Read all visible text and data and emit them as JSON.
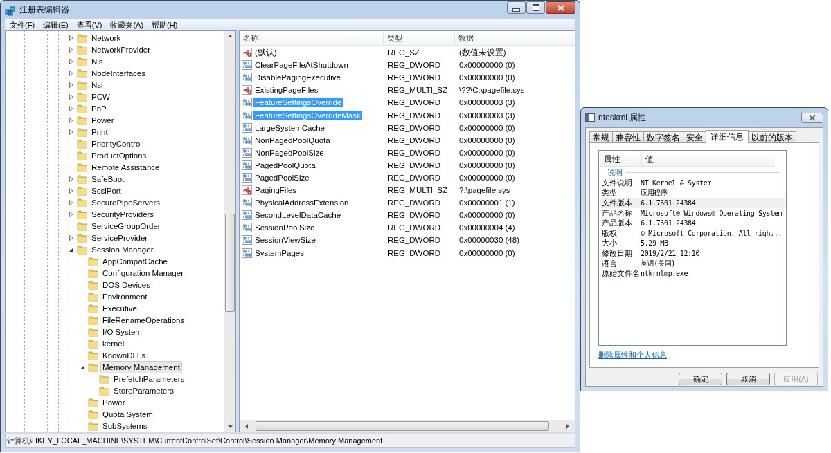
{
  "regedit": {
    "title": "注册表编辑器",
    "menu": [
      "文件(F)",
      "编辑(E)",
      "查看(V)",
      "收藏夹(A)",
      "帮助(H)"
    ],
    "tree": [
      {
        "label": "Network",
        "expanded": false,
        "selected": false
      },
      {
        "label": "NetworkProvider",
        "expanded": false,
        "selected": false
      },
      {
        "label": "Nls",
        "expanded": false,
        "selected": false
      },
      {
        "label": "NodeInterfaces",
        "expanded": false,
        "selected": false
      },
      {
        "label": "Nsi",
        "expanded": false,
        "selected": false
      },
      {
        "label": "PCW",
        "expanded": false,
        "selected": false
      },
      {
        "label": "PnP",
        "expanded": false,
        "selected": false
      },
      {
        "label": "Power",
        "expanded": false,
        "selected": false
      },
      {
        "label": "Print",
        "expanded": false,
        "selected": false
      },
      {
        "label": "PriorityControl",
        "selected": false
      },
      {
        "label": "ProductOptions",
        "selected": false
      },
      {
        "label": "Remote Assistance",
        "selected": false
      },
      {
        "label": "SafeBoot",
        "expanded": false,
        "selected": false
      },
      {
        "label": "ScsiPort",
        "expanded": false,
        "selected": false
      },
      {
        "label": "SecurePipeServers",
        "expanded": false,
        "selected": false
      },
      {
        "label": "SecurityProviders",
        "expanded": false,
        "selected": false
      },
      {
        "label": "ServiceGroupOrder",
        "selected": false
      },
      {
        "label": "ServiceProvider",
        "expanded": false,
        "selected": false
      },
      {
        "label": "Session Manager",
        "expanded": true,
        "selected": false,
        "children": [
          {
            "label": "AppCompatCache",
            "selected": false
          },
          {
            "label": "Configuration Manager",
            "selected": false
          },
          {
            "label": "DOS Devices",
            "selected": false
          },
          {
            "label": "Environment",
            "selected": false
          },
          {
            "label": "Executive",
            "selected": false
          },
          {
            "label": "FileRenameOperations",
            "selected": false
          },
          {
            "label": "I/O System",
            "selected": false
          },
          {
            "label": "kernel",
            "selected": false
          },
          {
            "label": "KnownDLLs",
            "selected": false
          },
          {
            "label": "Memory Management",
            "expanded": true,
            "selected": true,
            "children": [
              {
                "label": "PrefetchParameters",
                "selected": false
              },
              {
                "label": "StoreParameters",
                "selected": false
              }
            ]
          },
          {
            "label": "Power",
            "selected": false
          },
          {
            "label": "Quota System",
            "selected": false
          },
          {
            "label": "SubSystems",
            "selected": false
          }
        ]
      }
    ],
    "columns": [
      "名称",
      "类型",
      "数据"
    ],
    "values": [
      {
        "kind": "string",
        "name": "(默认)",
        "type": "REG_SZ",
        "data": "(数值未设置)",
        "selected": false
      },
      {
        "kind": "binary",
        "name": "ClearPageFileAtShutdown",
        "type": "REG_DWORD",
        "data": "0x00000000 (0)",
        "selected": false
      },
      {
        "kind": "binary",
        "name": "DisablePagingExecutive",
        "type": "REG_DWORD",
        "data": "0x00000000 (0)",
        "selected": false
      },
      {
        "kind": "string",
        "name": "ExistingPageFiles",
        "type": "REG_MULTI_SZ",
        "data": "\\??\\C:\\pagefile.sys",
        "selected": false
      },
      {
        "kind": "binary",
        "name": "FeatureSettingsOverride",
        "type": "REG_DWORD",
        "data": "0x00000003 (3)",
        "selected": true
      },
      {
        "kind": "binary",
        "name": "FeatureSettingsOverrideMask",
        "type": "REG_DWORD",
        "data": "0x00000003 (3)",
        "selected": true
      },
      {
        "kind": "binary",
        "name": "LargeSystemCache",
        "type": "REG_DWORD",
        "data": "0x00000000 (0)",
        "selected": false
      },
      {
        "kind": "binary",
        "name": "NonPagedPoolQuota",
        "type": "REG_DWORD",
        "data": "0x00000000 (0)",
        "selected": false
      },
      {
        "kind": "binary",
        "name": "NonPagedPoolSize",
        "type": "REG_DWORD",
        "data": "0x00000000 (0)",
        "selected": false
      },
      {
        "kind": "binary",
        "name": "PagedPoolQuota",
        "type": "REG_DWORD",
        "data": "0x00000000 (0)",
        "selected": false
      },
      {
        "kind": "binary",
        "name": "PagedPoolSize",
        "type": "REG_DWORD",
        "data": "0x00000000 (0)",
        "selected": false
      },
      {
        "kind": "string",
        "name": "PagingFiles",
        "type": "REG_MULTI_SZ",
        "data": "?:\\pagefile.sys",
        "selected": false
      },
      {
        "kind": "binary",
        "name": "PhysicalAddressExtension",
        "type": "REG_DWORD",
        "data": "0x00000001 (1)",
        "selected": false
      },
      {
        "kind": "binary",
        "name": "SecondLevelDataCache",
        "type": "REG_DWORD",
        "data": "0x00000000 (0)",
        "selected": false
      },
      {
        "kind": "binary",
        "name": "SessionPoolSize",
        "type": "REG_DWORD",
        "data": "0x00000004 (4)",
        "selected": false
      },
      {
        "kind": "binary",
        "name": "SessionViewSize",
        "type": "REG_DWORD",
        "data": "0x00000030 (48)",
        "selected": false
      },
      {
        "kind": "binary",
        "name": "SystemPages",
        "type": "REG_DWORD",
        "data": "0x00000000 (0)",
        "selected": false
      }
    ],
    "status_bar": "计算机\\HKEY_LOCAL_MACHINE\\SYSTEM\\CurrentControlSet\\Control\\Session Manager\\Memory Management"
  },
  "properties": {
    "title": "ntoskrnl 属性",
    "tabs": [
      {
        "label": "常规",
        "selected": false
      },
      {
        "label": "兼容性",
        "selected": false
      },
      {
        "label": "数字签名",
        "selected": false
      },
      {
        "label": "安全",
        "selected": false
      },
      {
        "label": "详细信息",
        "selected": true
      },
      {
        "label": "以前的版本",
        "selected": false
      }
    ],
    "columns": [
      "属性",
      "值"
    ],
    "group": "说明",
    "rows": [
      {
        "property": "文件说明",
        "value": "NT Kernel & System",
        "selected": false
      },
      {
        "property": "类型",
        "value": "应用程序",
        "selected": false
      },
      {
        "property": "文件版本",
        "value": "6.1.7601.24384",
        "selected": true
      },
      {
        "property": "产品名称",
        "value": "Microsoft® Windows® Operating System",
        "selected": false
      },
      {
        "property": "产品版本",
        "value": "6.1.7601.24384",
        "selected": false
      },
      {
        "property": "版权",
        "value": "© Microsoft Corporation. All righ...",
        "selected": false
      },
      {
        "property": "大小",
        "value": "5.29 MB",
        "selected": false
      },
      {
        "property": "修改日期",
        "value": "2019/2/21 12:10",
        "selected": false
      },
      {
        "property": "语言",
        "value": "英语(美国)",
        "selected": false
      },
      {
        "property": "原始文件名",
        "value": "ntkrnlmp.exe",
        "selected": false
      }
    ],
    "link": "删除属性和个人信息",
    "buttons": [
      {
        "label": "确定",
        "disabled": false
      },
      {
        "label": "取消",
        "disabled": false
      },
      {
        "label": "应用(A)",
        "disabled": true
      }
    ]
  }
}
